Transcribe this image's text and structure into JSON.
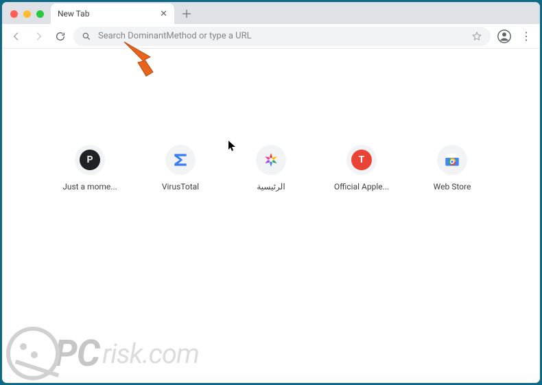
{
  "tab": {
    "title": "New Tab"
  },
  "omnibox": {
    "placeholder": "Search DominantMethod or type a URL"
  },
  "shortcuts": [
    {
      "label": "Just a mome...",
      "icon": "badge-dark",
      "glyph": "P"
    },
    {
      "label": "VirusTotal",
      "icon": "sigma"
    },
    {
      "label": "الرئيسية",
      "icon": "burst"
    },
    {
      "label": "Official Apple...",
      "icon": "badge-red",
      "glyph": "T"
    },
    {
      "label": "Web Store",
      "icon": "webstore"
    }
  ],
  "watermark": {
    "pc": "PC",
    "rest": "risk.com"
  }
}
